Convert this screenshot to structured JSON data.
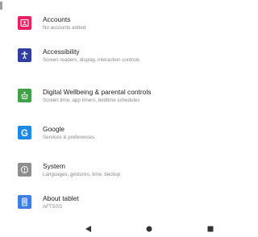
{
  "settings": {
    "items": [
      {
        "title": "Accounts",
        "subtitle": "No accounts added",
        "icon": "accounts-icon",
        "icon_color": "#e91e63"
      },
      {
        "title": "Accessibility",
        "subtitle": "Screen readers, display, interaction controls",
        "icon": "accessibility-icon",
        "icon_color": "#303f9f"
      },
      {
        "title": "Digital Wellbeing & parental controls",
        "subtitle": "Screen time, app timers, bedtime schedules",
        "icon": "digital-wellbeing-icon",
        "icon_color": "#43a047"
      },
      {
        "title": "Google",
        "subtitle": "Services & preferences",
        "icon": "google-icon",
        "icon_color": "#1e88e5"
      },
      {
        "title": "System",
        "subtitle": "Languages, gestures, time, backup",
        "icon": "system-icon",
        "icon_color": "#8e8e8e"
      },
      {
        "title": "About tablet",
        "subtitle": "AFTSSS",
        "icon": "tablet-icon",
        "icon_color": "#3f7de0"
      }
    ]
  },
  "navigation": {
    "buttons": [
      {
        "name": "back",
        "icon": "back-triangle-icon"
      },
      {
        "name": "home",
        "icon": "home-circle-icon"
      },
      {
        "name": "overview",
        "icon": "overview-square-icon"
      }
    ],
    "color": "#333333"
  }
}
